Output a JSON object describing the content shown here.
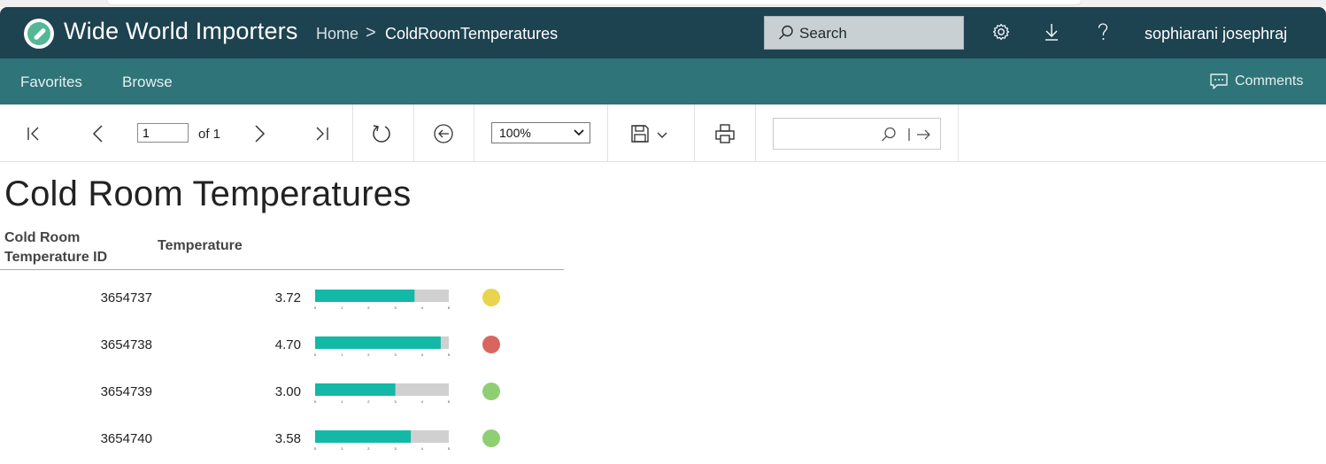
{
  "app": {
    "title": "Wide World Importers",
    "logo_icon": "compass-icon"
  },
  "breadcrumb": {
    "home": "Home",
    "separator": ">",
    "current": "ColdRoomTemperatures"
  },
  "search": {
    "label": "Search",
    "icon": "search-icon"
  },
  "header_icons": [
    "gear-icon",
    "download-icon",
    "help-icon"
  ],
  "user": {
    "name": "sophiarani josephraj"
  },
  "nav": {
    "favorites": "Favorites",
    "browse": "Browse",
    "comments": "Comments"
  },
  "toolbar": {
    "page_current": "1",
    "page_of": "of 1",
    "zoom": "100%",
    "icons": [
      "first-page-icon",
      "previous-page-icon",
      "next-page-icon",
      "last-page-icon",
      "refresh-icon",
      "back-icon",
      "save-icon",
      "print-icon",
      "find-icon",
      "find-next-icon"
    ]
  },
  "report": {
    "title": "Cold Room Temperatures",
    "columns": [
      "Cold Room Temperature ID",
      "Temperature"
    ],
    "gauge_ticks": [
      "0",
      "1",
      "2",
      "3",
      "4",
      "5"
    ],
    "gauge_max": 5,
    "colors": {
      "bar": "#14b8a6",
      "bar_bg": "#d0d0d0",
      "yellow": "#e8d44d",
      "red": "#d9665e",
      "green": "#8ecf73"
    },
    "rows": [
      {
        "id": "3654737",
        "temperature": "3.72",
        "value": 3.72,
        "status": "yellow"
      },
      {
        "id": "3654738",
        "temperature": "4.70",
        "value": 4.7,
        "status": "red"
      },
      {
        "id": "3654739",
        "temperature": "3.00",
        "value": 3.0,
        "status": "green"
      },
      {
        "id": "3654740",
        "temperature": "3.58",
        "value": 3.58,
        "status": "green"
      }
    ]
  }
}
